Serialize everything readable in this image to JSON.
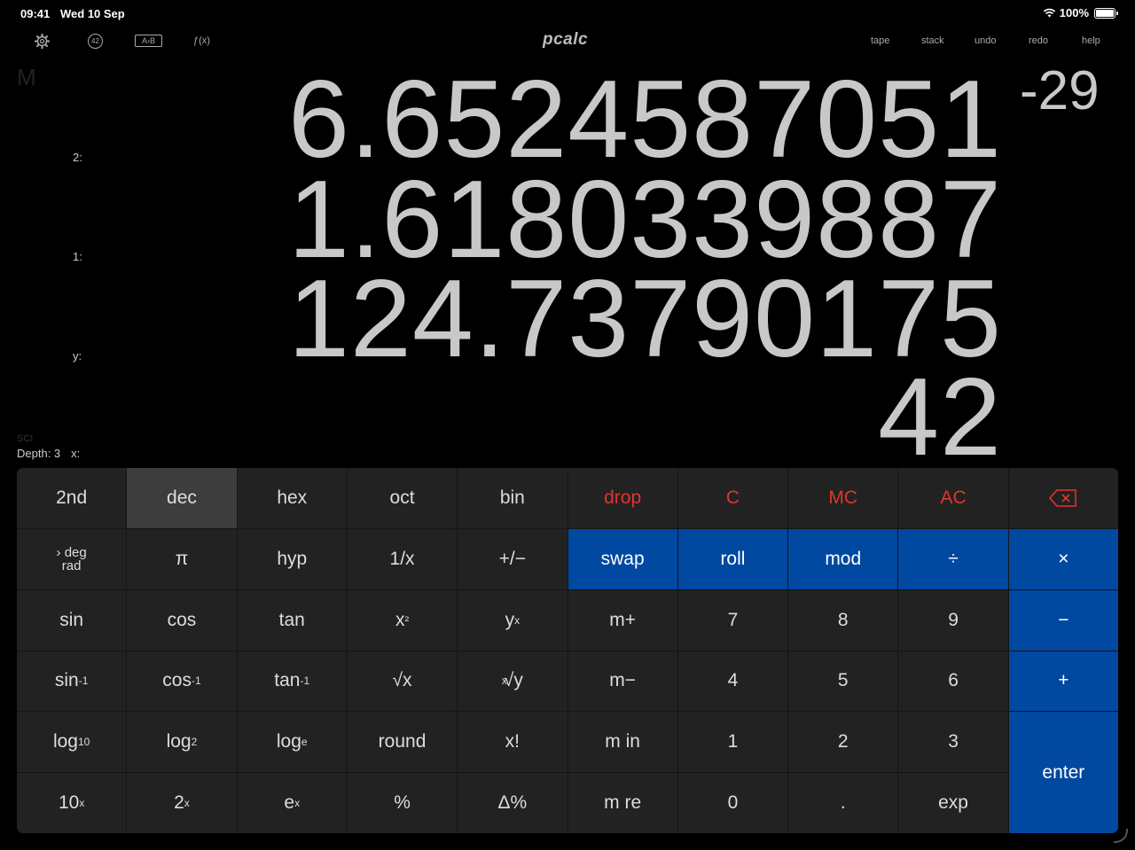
{
  "status": {
    "time": "09:41",
    "date": "Wed 10 Sep",
    "battery": "100%"
  },
  "toolbar": {
    "fx_label": "ƒ(x)",
    "icon_42": "42",
    "icon_ab": "A›B",
    "logo": "pcalc",
    "links": [
      "tape",
      "stack",
      "undo",
      "redo",
      "help"
    ]
  },
  "display": {
    "memory": "M",
    "labels": {
      "r2": "2:",
      "r1": "1:",
      "y": "y:",
      "x": "x:"
    },
    "mode": "SCI",
    "depth": "Depth: 3",
    "values": {
      "r2": "6.6524587051",
      "r1": "1.6180339887",
      "y": "124.73790175",
      "x": "42"
    },
    "exponent": "-29"
  },
  "keys": {
    "r1": [
      "2nd",
      "dec",
      "hex",
      "oct",
      "bin",
      "drop",
      "C",
      "MC",
      "AC",
      "⌫"
    ],
    "r2": [
      "deg",
      "rad",
      "π",
      "hyp",
      "1/x",
      "+/−",
      "swap",
      "roll",
      "mod",
      "÷",
      "×"
    ],
    "r3": [
      "sin",
      "cos",
      "tan",
      "x",
      "²",
      "y",
      "x",
      "m+",
      "7",
      "8",
      "9",
      "−"
    ],
    "r4": [
      "sin",
      "-1",
      "cos",
      "-1",
      "tan",
      "-1",
      "√x",
      "x",
      "√y",
      "m−",
      "4",
      "5",
      "6",
      "+"
    ],
    "r5": [
      "log",
      "10",
      "log",
      "2",
      "log",
      "e",
      "round",
      "x!",
      "m in",
      "1",
      "2",
      "3",
      "enter"
    ],
    "r6": [
      "10",
      "x",
      "2",
      "x",
      "e",
      "x",
      "%",
      "Δ%",
      "m re",
      "0",
      ".",
      "exp"
    ]
  },
  "colors": {
    "accent_blue": "#0048a0",
    "danger_red": "#e0352f",
    "key_bg": "#222222"
  }
}
